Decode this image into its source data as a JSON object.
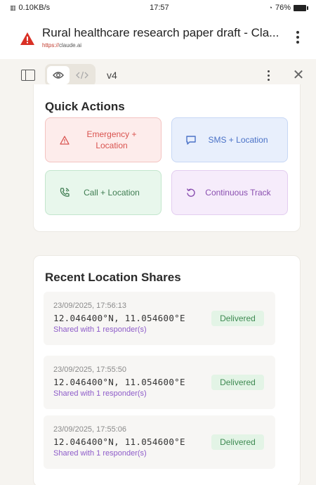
{
  "status_bar": {
    "network": "0.10KB/s",
    "time": "17:57",
    "battery": "76%"
  },
  "browser": {
    "page_title": "Rural healthcare research paper draft - Cla...",
    "url_scheme": "https://",
    "url_host": "claude.ai",
    "warning_icon": "warning-triangle-icon",
    "menu_icon": "kebab-menu-icon"
  },
  "artifact_toolbar": {
    "version": "v4",
    "preview_icon": "eye-icon",
    "code_icon": "code-icon",
    "sidebar_icon": "sidebar-icon",
    "close_glyph": "✕"
  },
  "quick_actions": {
    "title": "Quick Actions",
    "buttons": [
      {
        "label": "Emergency + Location",
        "icon": "warning-icon",
        "color": "#d9534f"
      },
      {
        "label": "SMS + Location",
        "icon": "message-icon",
        "color": "#4a72c7"
      },
      {
        "label": "Call + Location",
        "icon": "phone-icon",
        "color": "#3f7d52"
      },
      {
        "label": "Continuous Track",
        "icon": "refresh-icon",
        "color": "#8a4fb0"
      }
    ]
  },
  "recent_shares": {
    "title": "Recent Location Shares",
    "items": [
      {
        "timestamp": "23/09/2025, 17:56:13",
        "coords": "12.046400°N, 11.054600°E",
        "shared_with": "Shared with 1 responder(s)",
        "status": "Delivered"
      },
      {
        "timestamp": "23/09/2025, 17:55:50",
        "coords": "12.046400°N, 11.054600°E",
        "shared_with": "Shared with 1 responder(s)",
        "status": "Delivered"
      },
      {
        "timestamp": "23/09/2025, 17:55:06",
        "coords": "12.046400°N, 11.054600°E",
        "shared_with": "Shared with 1 responder(s)",
        "status": "Delivered"
      }
    ]
  }
}
